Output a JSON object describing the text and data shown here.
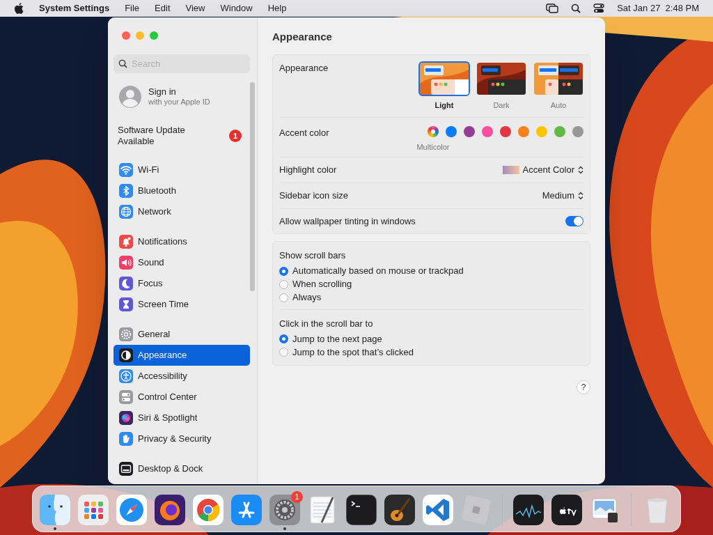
{
  "menu_bar": {
    "app": "System Settings",
    "items": [
      "File",
      "Edit",
      "View",
      "Window",
      "Help"
    ],
    "clock": "Sat Jan 27  2:48 PM"
  },
  "sidebar": {
    "search": {
      "placeholder": "Search"
    },
    "account": {
      "title": "Sign in",
      "subtitle": "with your Apple ID"
    },
    "update": {
      "label": "Software Update Available",
      "badge": "1"
    },
    "groups": [
      [
        {
          "label": "Wi-Fi",
          "kind": "wifi",
          "color": "#2f8bf0",
          "selected": false
        },
        {
          "label": "Bluetooth",
          "kind": "bluetooth",
          "color": "#2f8bf0",
          "selected": false
        },
        {
          "label": "Network",
          "kind": "globe",
          "color": "#2f8bf0",
          "selected": false
        }
      ],
      [
        {
          "label": "Notifications",
          "kind": "bell",
          "color": "#ee4b48",
          "selected": false
        },
        {
          "label": "Sound",
          "kind": "speaker",
          "color": "#ee3f66",
          "selected": false
        },
        {
          "label": "Focus",
          "kind": "moon",
          "color": "#5f56d8",
          "selected": false
        },
        {
          "label": "Screen Time",
          "kind": "hourglass",
          "color": "#5f56d8",
          "selected": false
        }
      ],
      [
        {
          "label": "General",
          "kind": "gear",
          "color": "#9a9a9e",
          "selected": false
        },
        {
          "label": "Appearance",
          "kind": "contrast",
          "color": "#1c1c1e",
          "selected": true
        },
        {
          "label": "Accessibility",
          "kind": "person",
          "color": "#2f8bf0",
          "selected": false
        },
        {
          "label": "Control Center",
          "kind": "toggles",
          "color": "#9a9a9e",
          "selected": false
        },
        {
          "label": "Siri & Spotlight",
          "kind": "orb",
          "color": "#3a2a5a",
          "selected": false
        },
        {
          "label": "Privacy & Security",
          "kind": "hand",
          "color": "#2f8bf0",
          "selected": false
        }
      ],
      [
        {
          "label": "Desktop & Dock",
          "kind": "dock",
          "color": "#1c1c1e",
          "selected": false
        }
      ]
    ]
  },
  "content": {
    "title": "Appearance",
    "appearance": {
      "label": "Appearance",
      "options": [
        {
          "label": "Light",
          "kind": "light",
          "selected": true
        },
        {
          "label": "Dark",
          "kind": "dark",
          "selected": false
        },
        {
          "label": "Auto",
          "kind": "auto",
          "selected": false
        }
      ]
    },
    "accent": {
      "label": "Accent color",
      "options": [
        {
          "kind": "multicolor",
          "label": "Multicolor",
          "selected": true
        },
        {
          "kind": "solid",
          "color": "#0a7aff",
          "selected": false
        },
        {
          "kind": "solid",
          "color": "#953d96",
          "selected": false
        },
        {
          "kind": "solid",
          "color": "#f74f9e",
          "selected": false
        },
        {
          "kind": "solid",
          "color": "#e0383e",
          "selected": false
        },
        {
          "kind": "solid",
          "color": "#f7821b",
          "selected": false
        },
        {
          "kind": "solid",
          "color": "#ffc600",
          "selected": false
        },
        {
          "kind": "solid",
          "color": "#62ba46",
          "selected": false
        },
        {
          "kind": "solid",
          "color": "#989898",
          "selected": false
        }
      ]
    },
    "highlight": {
      "label": "Highlight color",
      "value": "Accent Color"
    },
    "icon_size": {
      "label": "Sidebar icon size",
      "value": "Medium"
    },
    "tinting": {
      "label": "Allow wallpaper tinting in windows",
      "on": true
    },
    "scroll_groups": [
      {
        "title": "Show scroll bars",
        "options": [
          {
            "label": "Automatically based on mouse or trackpad",
            "selected": true
          },
          {
            "label": "When scrolling",
            "selected": false
          },
          {
            "label": "Always",
            "selected": false
          }
        ]
      },
      {
        "title": "Click in the scroll bar to",
        "options": [
          {
            "label": "Jump to the next page",
            "selected": true
          },
          {
            "label": "Jump to the spot that’s clicked",
            "selected": false
          }
        ]
      }
    ],
    "help": "?"
  },
  "dock": [
    {
      "kind": "finder",
      "running": true
    },
    {
      "kind": "launchpad"
    },
    {
      "kind": "safari"
    },
    {
      "kind": "firefox"
    },
    {
      "kind": "chrome"
    },
    {
      "kind": "appstore"
    },
    {
      "kind": "settings",
      "running": true,
      "badge": "1"
    },
    {
      "kind": "textedit"
    },
    {
      "kind": "terminal"
    },
    {
      "kind": "garageband"
    },
    {
      "kind": "vscode"
    },
    {
      "kind": "cube"
    },
    {
      "kind": "separator"
    },
    {
      "kind": "monitor"
    },
    {
      "kind": "tv"
    },
    {
      "kind": "preview"
    },
    {
      "kind": "separator"
    },
    {
      "kind": "trash"
    }
  ]
}
